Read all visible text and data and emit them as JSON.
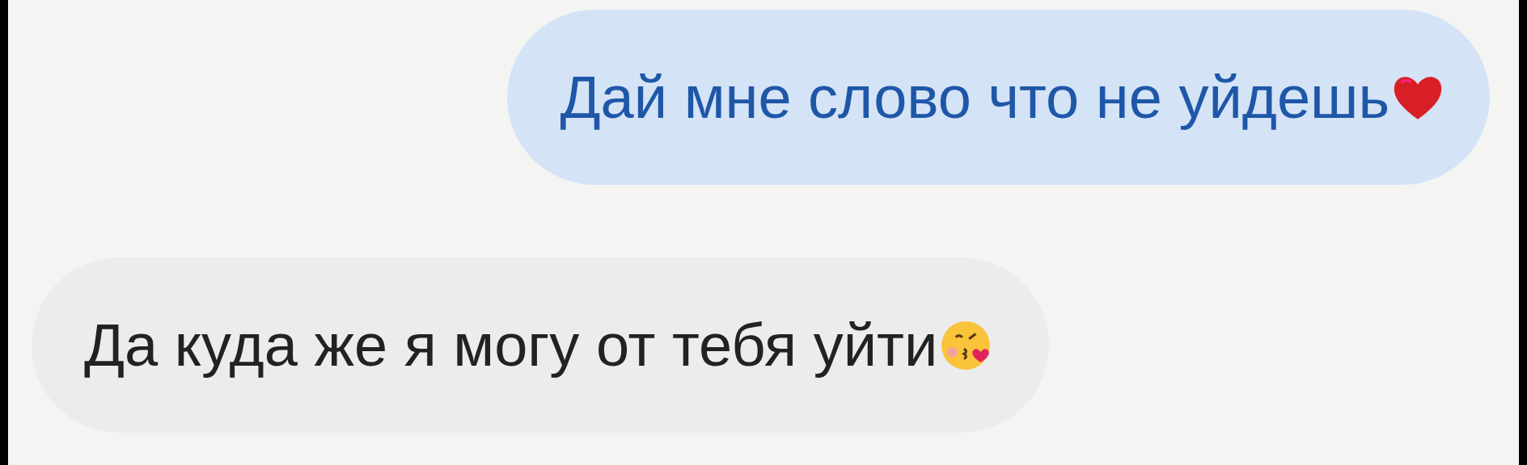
{
  "messages": [
    {
      "kind": "sent",
      "text": "Дай мне слово что не уйдешь"
    },
    {
      "kind": "received",
      "text": "Да куда же я могу от тебя уйти"
    }
  ]
}
